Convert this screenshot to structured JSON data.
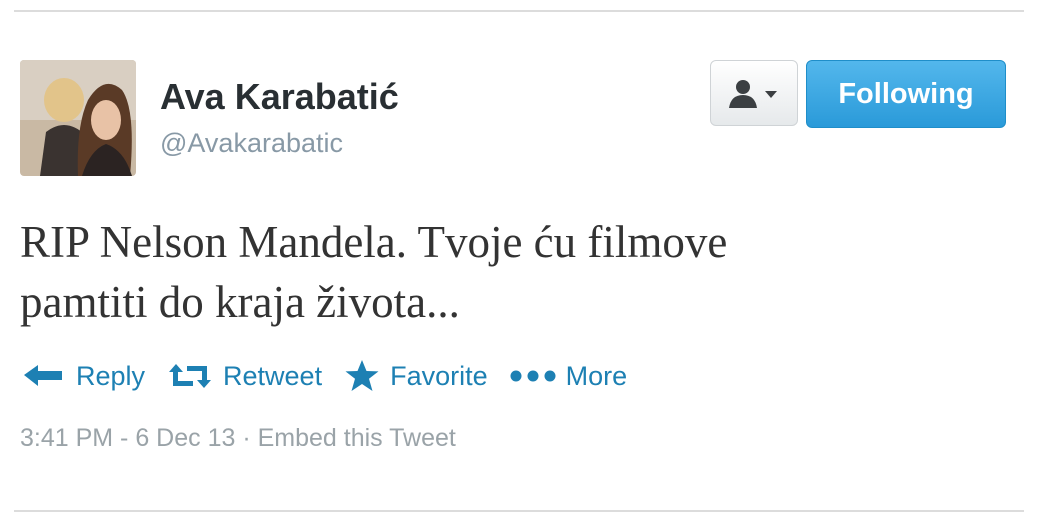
{
  "user": {
    "display_name": "Ava Karabatić",
    "handle": "@Avakarabatic"
  },
  "buttons": {
    "follow_label": "Following"
  },
  "tweet": {
    "line1": "RIP Nelson Mandela. Tvoje ću filmove",
    "line2": "pamtiti do kraja života..."
  },
  "actions": [
    {
      "label": "Reply",
      "icon": "reply-arrow-icon"
    },
    {
      "label": "Retweet",
      "icon": "retweet-icon"
    },
    {
      "label": "Favorite",
      "icon": "star-icon"
    },
    {
      "label": "More",
      "icon": "more-dots-icon"
    }
  ],
  "meta": {
    "timestamp": "3:41 PM - 6 Dec 13",
    "separator": " · ",
    "embed_label": "Embed this Tweet"
  },
  "colors": {
    "accent": "#1d80b3",
    "follow_button": "#2a9ad9",
    "muted": "#9aa3a8"
  }
}
